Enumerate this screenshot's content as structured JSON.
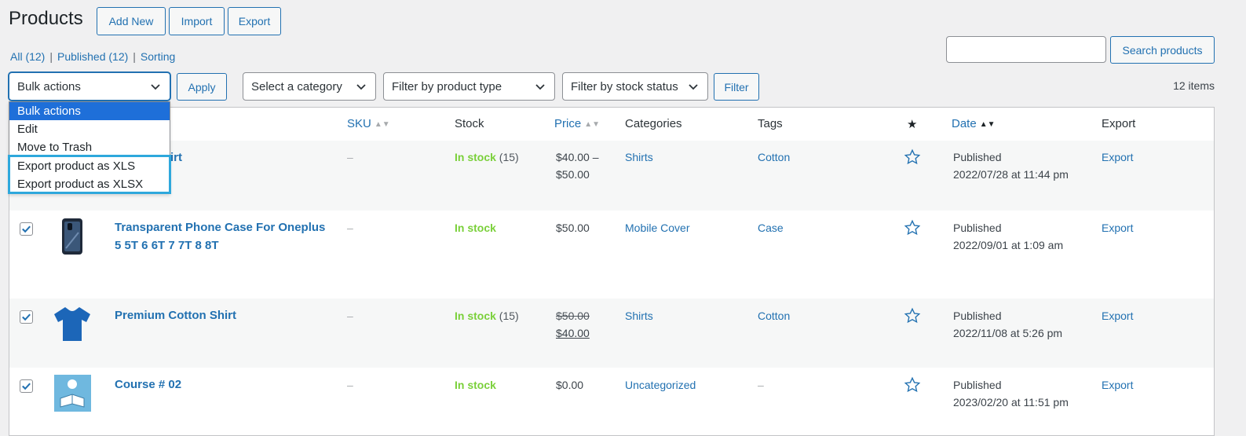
{
  "header": {
    "title": "Products",
    "buttons": {
      "add_new": "Add New",
      "import": "Import",
      "export": "Export"
    }
  },
  "views": {
    "all": "All (12)",
    "published": "Published (12)",
    "sorting": "Sorting",
    "separator": "|"
  },
  "search": {
    "value": "",
    "button": "Search products"
  },
  "filters": {
    "bulk_actions": "Bulk actions",
    "apply": "Apply",
    "category": "Select a category",
    "product_type": "Filter by product type",
    "stock_status": "Filter by stock status",
    "filter_button": "Filter"
  },
  "items_count": "12 items",
  "bulk_menu": {
    "options": [
      "Bulk actions",
      "Edit",
      "Move to Trash",
      "Export product as XLS",
      "Export product as XLSX"
    ],
    "selected_index": 0,
    "highlight_color": "#2ea8dc"
  },
  "table": {
    "columns": {
      "sku": "SKU",
      "stock": "Stock",
      "price": "Price",
      "categories": "Categories",
      "tags": "Tags",
      "featured": "★",
      "date": "Date",
      "export": "Export"
    },
    "rows": [
      {
        "checked": false,
        "name": "irt",
        "sku": "–",
        "stock": "In stock",
        "qty": "(15)",
        "price_line1": "$40.00 –",
        "price_line2": "$50.00",
        "category": "Shirts",
        "tags": "Cotton",
        "featured_icon": "star-outline-icon",
        "date_status": "Published",
        "date": "2022/07/28 at 11:44 pm",
        "export": "Export"
      },
      {
        "checked": true,
        "name": "Transparent Phone Case For Oneplus",
        "name_line2": "5 5T 6 6T 7 7T 8 8T",
        "thumb_icon": "phone-case-thumbnail",
        "sku": "–",
        "stock": "In stock",
        "qty": "",
        "price": "$50.00",
        "category": "Mobile Cover",
        "tags": "Case",
        "featured_icon": "star-outline-icon",
        "date_status": "Published",
        "date": "2022/09/01 at 1:09 am",
        "export": "Export"
      },
      {
        "checked": true,
        "name": "Premium Cotton Shirt",
        "thumb_icon": "tshirt-thumbnail",
        "sku": "–",
        "stock": "In stock",
        "qty": "(15)",
        "price_regular": "$50.00",
        "price_sale": "$40.00",
        "category": "Shirts",
        "tags": "Cotton",
        "featured_icon": "star-outline-icon",
        "date_status": "Published",
        "date": "2022/11/08 at 5:26 pm",
        "export": "Export"
      },
      {
        "checked": true,
        "name": "Course # 02",
        "thumb_icon": "course-thumbnail",
        "sku": "–",
        "stock": "In stock",
        "qty": "",
        "price": "$0.00",
        "category": "Uncategorized",
        "tags": "–",
        "featured_icon": "star-outline-icon",
        "date_status": "Published",
        "date": "2023/02/20 at 11:51 pm",
        "export": "Export"
      }
    ]
  },
  "colors": {
    "accent": "#2271b1",
    "in_stock": "#7ad03a",
    "menu_selected": "#1e6fd9"
  }
}
